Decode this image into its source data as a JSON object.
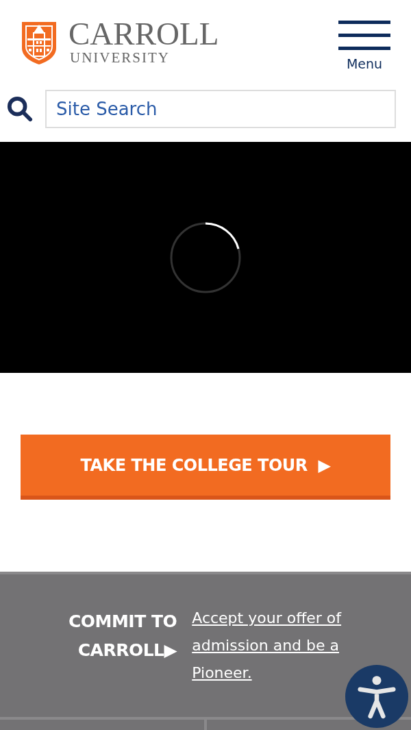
{
  "header": {
    "logo_name": "CARROLL",
    "logo_subtitle": "UNIVERSITY",
    "menu_label": "Menu"
  },
  "search": {
    "placeholder": "Site Search"
  },
  "video": {
    "loading": true
  },
  "tour_button": {
    "label": "TAKE THE COLLEGE TOUR",
    "arrow": "▶"
  },
  "commit": {
    "heading_lines": [
      "COMMIT TO",
      "CARROLL"
    ],
    "arrow": "▶",
    "link": "Accept your offer of admission and be a Pioneer."
  }
}
